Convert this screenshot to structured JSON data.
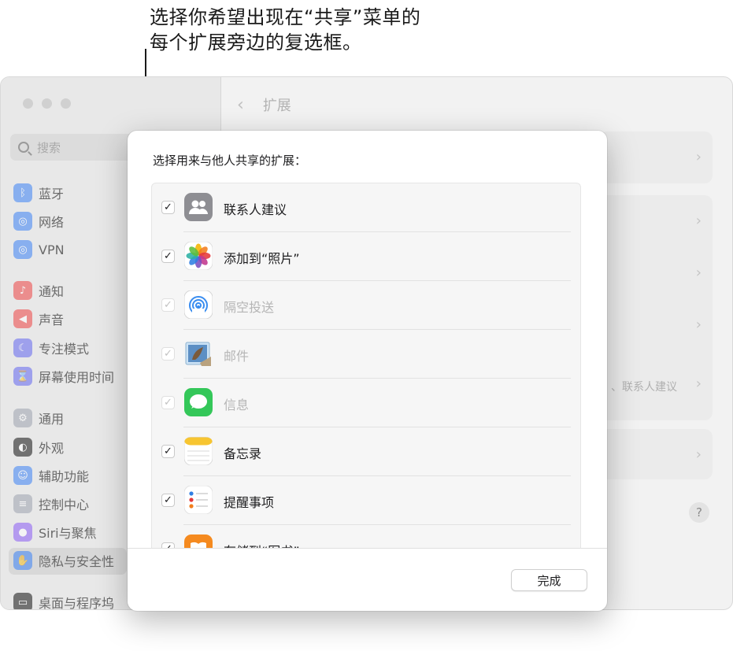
{
  "callout": {
    "line1": "选择你希望出现在“共享”菜单的",
    "line2": "每个扩展旁边的复选框。"
  },
  "window": {
    "header_title": "扩展",
    "search_placeholder": "搜索",
    "sidebar_items": [
      {
        "label": "蓝牙",
        "icon": "bluetooth-icon",
        "color": "#3b82f6"
      },
      {
        "label": "网络",
        "icon": "globe-icon",
        "color": "#3b82f6"
      },
      {
        "label": "VPN",
        "icon": "globe-vpn-icon",
        "color": "#3b82f6"
      },
      {
        "label": "通知",
        "icon": "bell-icon",
        "color": "#ef4444"
      },
      {
        "label": "声音",
        "icon": "speaker-icon",
        "color": "#ef4444"
      },
      {
        "label": "专注模式",
        "icon": "moon-icon",
        "color": "#6366f1"
      },
      {
        "label": "屏幕使用时间",
        "icon": "hourglass-icon",
        "color": "#6366f1"
      },
      {
        "label": "通用",
        "icon": "gear-icon",
        "color": "#9ca3af"
      },
      {
        "label": "外观",
        "icon": "appearance-icon",
        "color": "#111111"
      },
      {
        "label": "辅助功能",
        "icon": "accessibility-icon",
        "color": "#3b82f6"
      },
      {
        "label": "控制中心",
        "icon": "toggles-icon",
        "color": "#9ca3af"
      },
      {
        "label": "Siri与聚焦",
        "icon": "siri-icon",
        "color": "#8b5cf6"
      },
      {
        "label": "隐私与安全性",
        "icon": "hand-icon",
        "color": "#3b82f6"
      },
      {
        "label": "桌面与程序坞",
        "icon": "dock-icon",
        "color": "#111111"
      }
    ],
    "bg_partial_text": "、联系人建议",
    "help_label": "?"
  },
  "dialog": {
    "title": "选择用来与他人共享的扩展：",
    "items": [
      {
        "label": "联系人建议",
        "checked": true,
        "disabled": false,
        "icon": "contacts-suggestions-icon"
      },
      {
        "label": "添加到“照片”",
        "checked": true,
        "disabled": false,
        "icon": "photos-icon"
      },
      {
        "label": "隔空投送",
        "checked": true,
        "disabled": true,
        "icon": "airdrop-icon"
      },
      {
        "label": "邮件",
        "checked": true,
        "disabled": true,
        "icon": "mail-icon"
      },
      {
        "label": "信息",
        "checked": true,
        "disabled": true,
        "icon": "messages-icon"
      },
      {
        "label": "备忘录",
        "checked": true,
        "disabled": false,
        "icon": "notes-icon"
      },
      {
        "label": "提醒事项",
        "checked": true,
        "disabled": false,
        "icon": "reminders-icon"
      },
      {
        "label": "存储到“图书”",
        "checked": true,
        "disabled": false,
        "icon": "books-icon"
      }
    ],
    "check_glyph": "✓",
    "done_label": "完成"
  }
}
